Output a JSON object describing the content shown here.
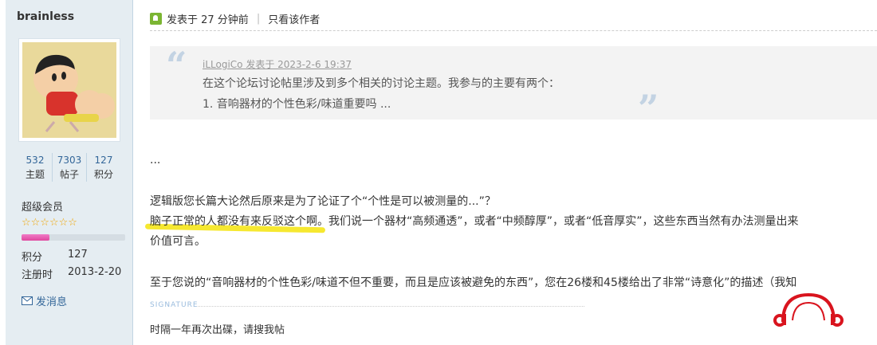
{
  "user": {
    "name": "brainless",
    "stats": [
      {
        "value": "532",
        "label": "主题"
      },
      {
        "value": "7303",
        "label": "帖子"
      },
      {
        "value": "127",
        "label": "积分"
      }
    ],
    "group": "超级会员",
    "stars": "☆☆☆☆☆☆",
    "level_progress": 0.27,
    "points_label": "积分",
    "points_value": "127",
    "register_label": "注册时",
    "register_value": "2013-2-20",
    "pm_label": "发消息"
  },
  "post": {
    "posted": "发表于 27 分钟前",
    "author_only": "只看该作者",
    "quote": {
      "author": "iLLogiCo 发表于 2023-2-6 19:37",
      "line1": "在这个论坛讨论帖里涉及到多个相关的讨论主题。我参与的主要有两个：",
      "line2": "1. 音响器材的个性色彩/味道重要吗 ..."
    },
    "ellipsis": "...",
    "para1": "逻辑版您长篇大论然后原来是为了论证了个“个性是可以被测量的...”？",
    "para2_highlight": "脑子正常的人都没有来反驳这个啊",
    "para2_rest": "。我们说一个器材“高频通透”，或者“中频醇厚”，或者“低音厚实”，这些东西当然有办法测量出来",
    "para3": "价值可言。",
    "para4": "至于您说的“音响器材的个性色彩/味道不但不重要，而且是应该被避免的东西”，您在26楼和45楼给出了非常“诗意化”的描述（我知",
    "signature_label": "SIGNATURE",
    "signature": "时隔一年再次出碟，请搜我帖"
  },
  "colors": {
    "sidebar_bg": "#e5edf2",
    "link": "#336699",
    "highlight": "#f5e51a",
    "logo_red": "#d9141e"
  }
}
